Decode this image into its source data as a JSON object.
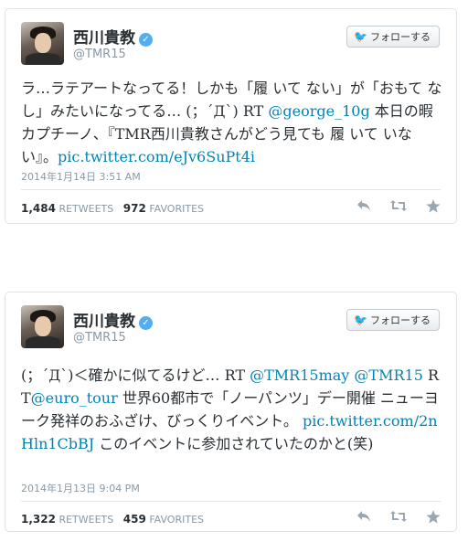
{
  "follow_label": "フォローする",
  "tweets": [
    {
      "name": "西川貴教",
      "handle": "@TMR15",
      "text_1": "ラ…ラテアートなってる！しかも「履 いて ない」が「おもて なし」みたいになってる… (；´Д`) RT ",
      "mention_1": "@george_10g",
      "text_2": " 本日の暇カプチーノ、『TMR西川貴教さんがどう見ても 履 いて いない』。",
      "link": "pic.twitter.com/eJv6SuPt4i",
      "timestamp": "2014年1月14日 3:51 AM",
      "retweets": "1,484",
      "retweets_label": "RETWEETS",
      "favorites": "972",
      "favorites_label": "FAVORITES"
    },
    {
      "name": "西川貴教",
      "handle": "@TMR15",
      "text_1": "(；´Д`)＜確かに似てるけど… RT ",
      "mention_1": "@TMR15may",
      "mention_2": "@TMR15",
      "text_2": " RT",
      "mention_3": "@euro_tour",
      "text_3": " 世界60都市で「ノーパンツ」デー開催 ニューヨーク発祥のおふざけ、びっくりイベント。 ",
      "link": "pic.twitter.com/2nHln1CbBJ",
      "text_4": " このイベントに参加されていたのかと(笑)",
      "timestamp": "2014年1月13日 9:04 PM",
      "retweets": "1,322",
      "retweets_label": "RETWEETS",
      "favorites": "459",
      "favorites_label": "FAVORITES"
    }
  ],
  "icons": [
    "verified-icon",
    "twitter-bird-icon",
    "reply-icon",
    "retweet-icon",
    "favorite-icon"
  ],
  "colors": {
    "link": "#0084b4",
    "verified": "#55acee",
    "meta": "#8899a6"
  }
}
